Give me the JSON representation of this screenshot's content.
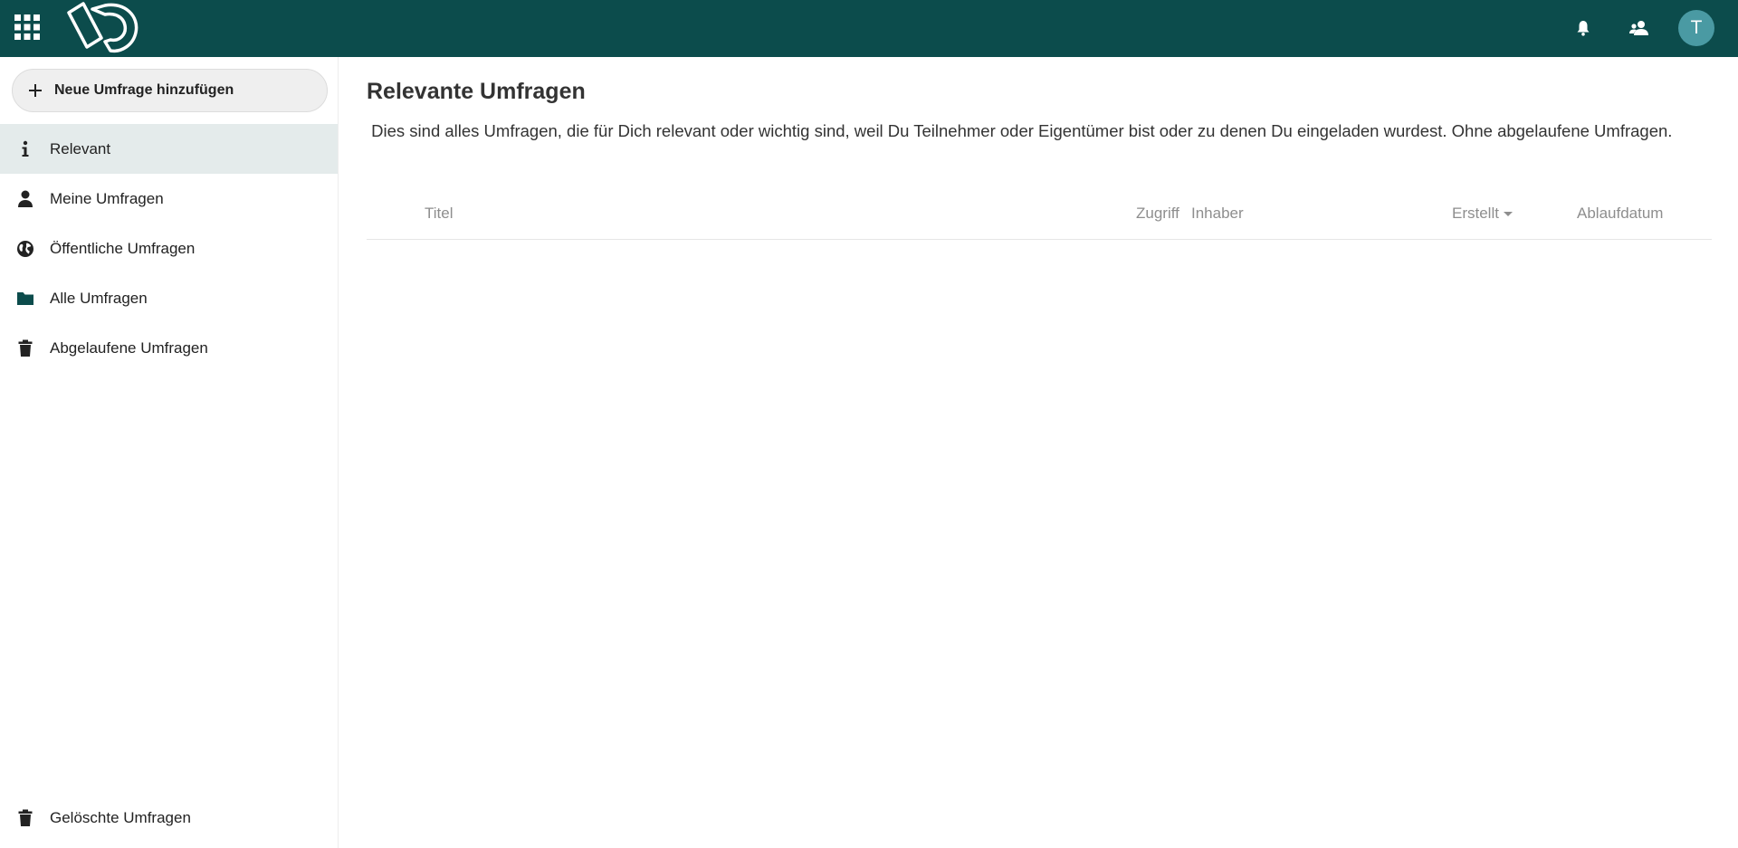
{
  "header": {
    "apps_icon": "grid-icon",
    "logo_icon": "app-logo",
    "notifications_icon": "bell-icon",
    "contacts_icon": "contacts-icon",
    "avatar_initial": "T",
    "avatar_color": "#4a9aa3",
    "background_color": "#0c4c4c"
  },
  "sidebar": {
    "new_button": {
      "icon": "plus-icon",
      "label": "Neue Umfrage hinzufügen"
    },
    "items": [
      {
        "id": "relevant",
        "label": "Relevant",
        "icon": "info-icon",
        "active": true
      },
      {
        "id": "my",
        "label": "Meine Umfragen",
        "icon": "user-icon",
        "active": false
      },
      {
        "id": "public",
        "label": "Öffentliche Umfragen",
        "icon": "globe-icon",
        "active": false
      },
      {
        "id": "all",
        "label": "Alle Umfragen",
        "icon": "folder-icon",
        "active": false
      },
      {
        "id": "expired",
        "label": "Abgelaufene Umfragen",
        "icon": "trash-icon",
        "active": false
      }
    ],
    "footer_item": {
      "id": "deleted",
      "label": "Gelöschte Umfragen",
      "icon": "trash-icon"
    }
  },
  "main": {
    "title": "Relevante Umfragen",
    "description": " Dies sind alles Umfragen, die für Dich relevant oder wichtig sind, weil Du Teilnehmer oder Eigentümer bist oder zu denen Du eingeladen wurdest. Ohne abgelaufene Umfragen.",
    "table": {
      "columns": {
        "title": "Titel",
        "access": "Zugriff",
        "owner": "Inhaber",
        "created": "Erstellt",
        "expiry": "Ablaufdatum"
      },
      "sorted_by": "created",
      "rows": []
    }
  }
}
